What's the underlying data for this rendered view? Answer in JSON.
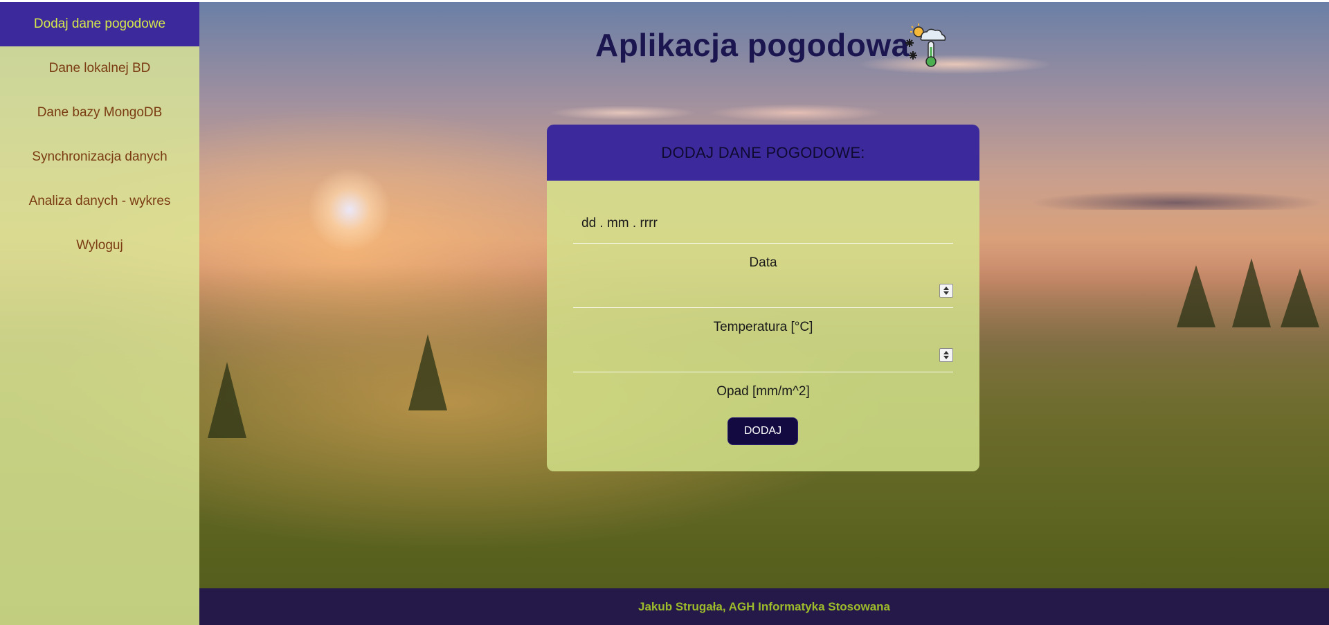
{
  "app": {
    "title": "Aplikacja pogodowa",
    "weather_icon": "weather-snow-sun-thermometer-icon"
  },
  "sidebar": {
    "items": [
      {
        "label": "Dodaj dane pogodowe",
        "active": true
      },
      {
        "label": "Dane lokalnej BD",
        "active": false
      },
      {
        "label": "Dane bazy MongoDB",
        "active": false
      },
      {
        "label": "Synchronizacja danych",
        "active": false
      },
      {
        "label": "Analiza danych - wykres",
        "active": false
      },
      {
        "label": "Wyloguj",
        "active": false
      }
    ]
  },
  "form": {
    "header": "DODAJ DANE POGODOWE:",
    "date_placeholder": "dd . mm . rrrr",
    "date_label": "Data",
    "temperature_value": "",
    "temperature_label": "Temperatura [°C]",
    "precipitation_value": "",
    "precipitation_label": "Opad [mm/m^2]",
    "submit_label": "DODAJ"
  },
  "footer": {
    "text": "Jakub Strugała, AGH Informatyka Stosowana"
  },
  "colors": {
    "sidebar_bg": "#dae696",
    "active_bg": "#3c2a9c",
    "active_text": "#d6e84a",
    "nav_text": "#7a3a12",
    "title_text": "#1c1650",
    "button_bg": "#120a40",
    "footer_bg": "#1e1050",
    "footer_text": "#9dbb2a"
  }
}
